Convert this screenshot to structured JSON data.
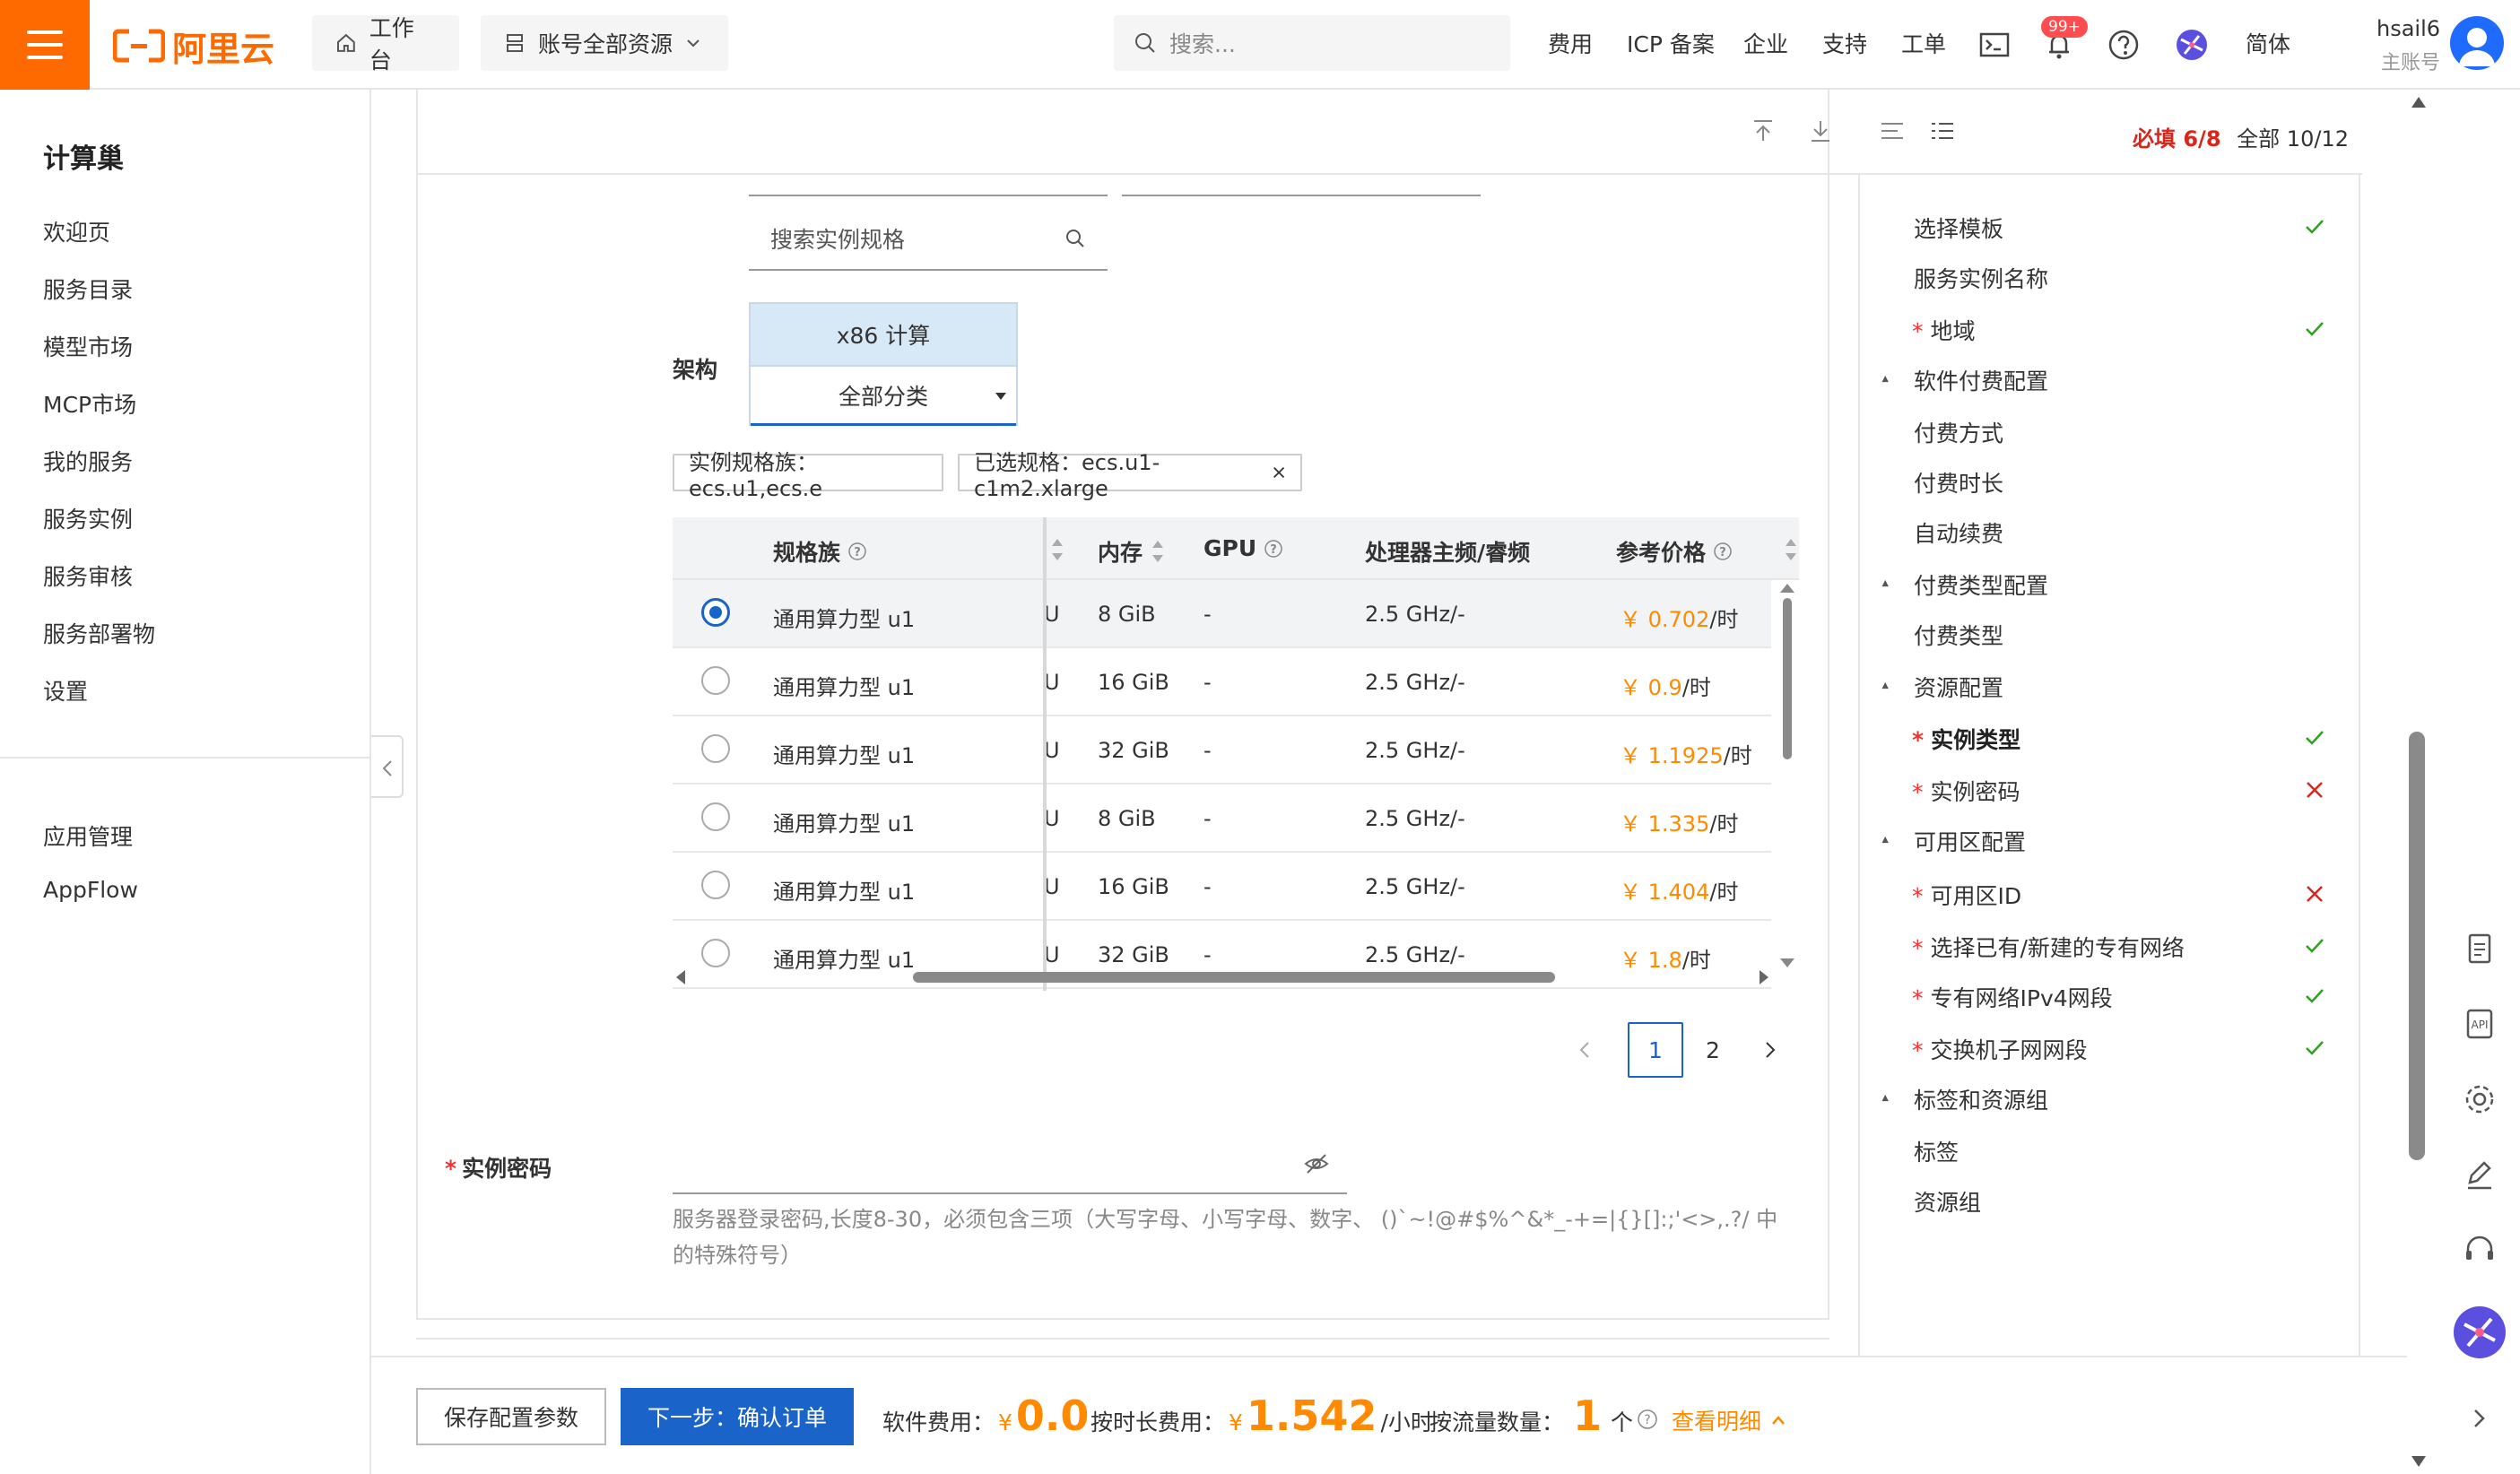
{
  "topbar": {
    "logo_text": "阿里云",
    "workbench": "工作台",
    "resources": "账号全部资源",
    "search_placeholder": "搜索...",
    "links": [
      "费用",
      "ICP 备案",
      "企业",
      "支持",
      "工单"
    ],
    "badge": "99+",
    "lang": "简体",
    "user_name": "hsail6",
    "user_role": "主账号"
  },
  "sidebar": {
    "title": "计算巢",
    "items": [
      "欢迎页",
      "服务目录",
      "模型市场",
      "MCP市场",
      "我的服务",
      "服务实例",
      "服务审核",
      "服务部署物",
      "设置"
    ],
    "items2": [
      "应用管理",
      "AppFlow"
    ]
  },
  "form": {
    "spec_search_placeholder": "搜索实例规格",
    "arch_label": "架构",
    "arch_selected": "x86 计算",
    "arch_category": "全部分类",
    "tag_family": "实例规格族：ecs.u1,ecs.e",
    "tag_selected": "已选规格：ecs.u1-c1m2.xlarge",
    "password_label": "实例密码",
    "password_hint": "服务器登录密码,长度8-30，必须包含三项（大写字母、小写字母、数字、 ()`~!@#$%^&*_-+=|{}[]:;'<>,.?/ 中的特殊符号）"
  },
  "table": {
    "headers": {
      "family": "规格族",
      "memory": "内存",
      "gpu": "GPU",
      "freq": "处理器主频/睿频",
      "price": "参考价格"
    },
    "rows": [
      {
        "family": "通用算力型 u1",
        "cpu_frag": "U",
        "memory": "8 GiB",
        "gpu": "-",
        "freq": "2.5 GHz/-",
        "yen": "￥",
        "price": "0.702",
        "unit": "/时",
        "selected": true
      },
      {
        "family": "通用算力型 u1",
        "cpu_frag": "U",
        "memory": "16 GiB",
        "gpu": "-",
        "freq": "2.5 GHz/-",
        "yen": "￥",
        "price": "0.9",
        "unit": "/时",
        "selected": false
      },
      {
        "family": "通用算力型 u1",
        "cpu_frag": "U",
        "memory": "32 GiB",
        "gpu": "-",
        "freq": "2.5 GHz/-",
        "yen": "￥",
        "price": "1.1925",
        "unit": "/时",
        "selected": false
      },
      {
        "family": "通用算力型 u1",
        "cpu_frag": "U",
        "memory": "8 GiB",
        "gpu": "-",
        "freq": "2.5 GHz/-",
        "yen": "￥",
        "price": "1.335",
        "unit": "/时",
        "selected": false
      },
      {
        "family": "通用算力型 u1",
        "cpu_frag": "U",
        "memory": "16 GiB",
        "gpu": "-",
        "freq": "2.5 GHz/-",
        "yen": "￥",
        "price": "1.404",
        "unit": "/时",
        "selected": false
      },
      {
        "family": "通用算力型 u1",
        "cpu_frag": "U",
        "memory": "32 GiB",
        "gpu": "-",
        "freq": "2.5 GHz/-",
        "yen": "￥",
        "price": "1.8",
        "unit": "/时",
        "selected": false
      }
    ]
  },
  "pagination": {
    "pages": [
      "1",
      "2"
    ],
    "current": "1"
  },
  "right_panel": {
    "required_label": "必填 6/8",
    "all_label": "全部 10/12",
    "items": [
      {
        "label": "选择模板",
        "status": "ok"
      },
      {
        "label": "服务实例名称",
        "status": ""
      },
      {
        "label": "地域",
        "status": "ok",
        "required": true
      },
      {
        "label": "软件付费配置",
        "group": true
      },
      {
        "label": "付费方式",
        "status": ""
      },
      {
        "label": "付费时长",
        "status": ""
      },
      {
        "label": "自动续费",
        "status": ""
      },
      {
        "label": "付费类型配置",
        "group": true
      },
      {
        "label": "付费类型",
        "status": ""
      },
      {
        "label": "资源配置",
        "group": true
      },
      {
        "label": "实例类型",
        "status": "ok",
        "required": true,
        "active": true
      },
      {
        "label": "实例密码",
        "status": "error",
        "required": true
      },
      {
        "label": "可用区配置",
        "group": true
      },
      {
        "label": "可用区ID",
        "status": "error",
        "required": true
      },
      {
        "label": "选择已有/新建的专有网络",
        "status": "ok",
        "required": true
      },
      {
        "label": "专有网络IPv4网段",
        "status": "ok",
        "required": true
      },
      {
        "label": "交换机子网网段",
        "status": "ok",
        "required": true
      },
      {
        "label": "标签和资源组",
        "group": true
      },
      {
        "label": "标签",
        "status": ""
      },
      {
        "label": "资源组",
        "status": ""
      }
    ]
  },
  "bottom": {
    "save_label": "保存配置参数",
    "next_label": "下一步：确认订单",
    "software_fee_label": "软件费用：",
    "software_fee_yen": "¥",
    "software_fee": "0.0",
    "hourly_fee_label": "按时长费用：",
    "hourly_fee_yen": "¥",
    "hourly_fee": "1.542",
    "hourly_unit": "/小时",
    "traffic_label": "按流量数量：",
    "traffic_count": "1",
    "traffic_unit": "个",
    "detail_label": "查看明细"
  },
  "colors": {
    "brand": "#ff6a00",
    "primary": "#1a63c9",
    "price": "#ff8a00",
    "ok": "#2ea121",
    "error": "#d9261c"
  }
}
